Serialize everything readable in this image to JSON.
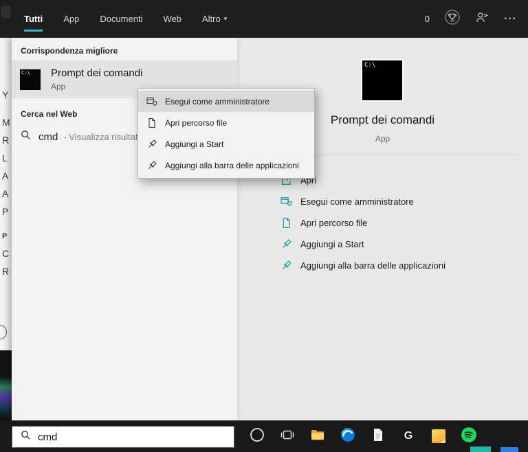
{
  "colors": {
    "accent_teal": "#35b9bd",
    "action_icon_teal": "#1b9fa6",
    "topbar_bg": "#1f1f1f",
    "left_panel_bg": "#f2f2f2",
    "right_panel_bg": "#e8e8e8",
    "row_highlight": "#e2e2e2",
    "menu_highlight": "#d9d9d9",
    "taskbar_bg": "#191919",
    "spotify_green": "#1ed760"
  },
  "icons": {
    "chevron_down": "▾",
    "more": "···",
    "gog_letter": "G"
  },
  "cmd_icon_label": "C:\\",
  "topbar": {
    "tabs": [
      {
        "label": "Tutti"
      },
      {
        "label": "App"
      },
      {
        "label": "Documenti"
      },
      {
        "label": "Web"
      },
      {
        "label": "Altro"
      }
    ],
    "rewards_count": "0"
  },
  "left_panel": {
    "best_match_header": "Corrispondenza migliore",
    "best_match": {
      "title": "Prompt dei comandi",
      "subtitle": "App"
    },
    "web_header": "Cerca nel Web",
    "web": {
      "query": "cmd",
      "hint": "- Visualizza risultati W"
    }
  },
  "edge_strip": {
    "letters": [
      "Y",
      "M",
      "R",
      "L",
      "A",
      "A",
      "P",
      "P",
      "C",
      "R"
    ]
  },
  "context_menu": {
    "items": [
      {
        "label": "Esegui come amministratore"
      },
      {
        "label": "Apri percorso file"
      },
      {
        "label": "Aggiungi a Start"
      },
      {
        "label": "Aggiungi alla barra delle applicazioni"
      }
    ]
  },
  "details": {
    "title": "Prompt dei comandi",
    "subtitle": "App",
    "actions": [
      {
        "label": "Apri"
      },
      {
        "label": "Esegui come amministratore"
      },
      {
        "label": "Apri percorso file"
      },
      {
        "label": "Aggiungi a Start"
      },
      {
        "label": "Aggiungi alla barra delle applicazioni"
      }
    ]
  },
  "search_box": {
    "value": "cmd"
  },
  "taskbar": {
    "apps": [
      "Cortana",
      "Task View",
      "File Explorer",
      "Microsoft Edge",
      "Document",
      "GOG",
      "Notes",
      "Spotify"
    ]
  }
}
